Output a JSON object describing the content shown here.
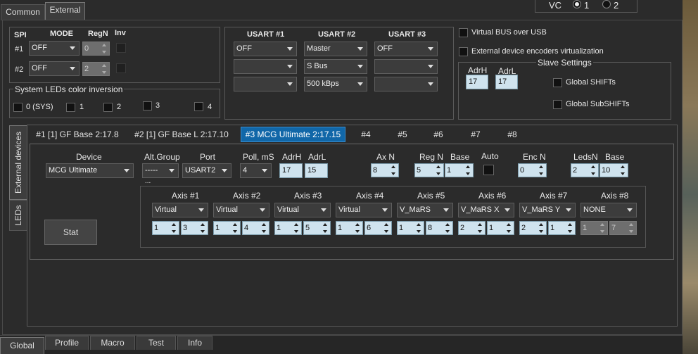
{
  "top_tabs": [
    "Common",
    "External"
  ],
  "vc": {
    "label": "VC",
    "options": [
      "1",
      "2"
    ]
  },
  "spi": {
    "title": "SPI",
    "mode_header": "MODE",
    "regn_header": "RegN",
    "inv_header": "Inv",
    "rows": [
      {
        "label": "#1",
        "mode": "OFF",
        "regn": "0"
      },
      {
        "label": "#2",
        "mode": "OFF",
        "regn": "2"
      }
    ]
  },
  "leds_inv": {
    "title": "System LEDs color inversion",
    "items": [
      "0 (SYS)",
      "1",
      "2",
      "3",
      "4"
    ]
  },
  "usart": {
    "headers": [
      "USART #1",
      "USART #2",
      "USART #3"
    ],
    "col1": [
      "OFF",
      "",
      ""
    ],
    "col2": [
      "Master",
      "S Bus",
      "500 kBps"
    ],
    "col3": [
      "OFF",
      "",
      ""
    ]
  },
  "virtual_bus": "Virtual BUS over USB",
  "ext_enc": "External device encoders virtualization",
  "slave": {
    "title": "Slave Settings",
    "adrh_label": "AdrH",
    "adrl_label": "AdrL",
    "adrh": "17",
    "adrl": "17",
    "global_shifts": "Global SHIFTs",
    "global_subshifts": "Global SubSHIFTs"
  },
  "side_tabs": [
    "External devices",
    "LEDs"
  ],
  "device_tabs": [
    "#1 [1] GF Base 2:17.8",
    "#2 [1] GF Base L 2:17.10",
    "#3 MCG Ultimate 2:17.15",
    "#4",
    "#5",
    "#6",
    "#7",
    "#8"
  ],
  "device": {
    "headers": {
      "device": "Device",
      "altgroup": "Alt.Group",
      "port": "Port",
      "poll": "Poll, mS",
      "adrh": "AdrH",
      "adrl": "AdrL",
      "axn": "Ax N",
      "regn": "Reg N",
      "base": "Base",
      "auto": "Auto",
      "encn": "Enc N",
      "ledsn": "LedsN",
      "base2": "Base"
    },
    "values": {
      "device": "MCG Ultimate",
      "altgroup": "-----",
      "ellipsis": "...",
      "port": "USART2",
      "poll": "4",
      "adrh": "17",
      "adrl": "15",
      "axn": "8",
      "regn": "5",
      "base": "1",
      "encn": "0",
      "ledsn": "2",
      "base2": "10"
    }
  },
  "axes": [
    {
      "label": "Axis #1",
      "type": "Virtual",
      "a": "1",
      "b": "3"
    },
    {
      "label": "Axis #2",
      "type": "Virtual",
      "a": "1",
      "b": "4"
    },
    {
      "label": "Axis #3",
      "type": "Virtual",
      "a": "1",
      "b": "5"
    },
    {
      "label": "Axis #4",
      "type": "Virtual",
      "a": "1",
      "b": "6"
    },
    {
      "label": "Axis #5",
      "type": "V_MaRS",
      "a": "1",
      "b": "8"
    },
    {
      "label": "Axis #6",
      "type": "V_MaRS X",
      "a": "2",
      "b": "1"
    },
    {
      "label": "Axis #7",
      "type": "V_MaRS Y",
      "a": "2",
      "b": "1"
    },
    {
      "label": "Axis #8",
      "type": "NONE",
      "a": "1",
      "b": "7"
    }
  ],
  "stat_button": "Stat",
  "bottom_tabs": [
    "Global",
    "Profile",
    "Macro",
    "Test",
    "Info"
  ]
}
